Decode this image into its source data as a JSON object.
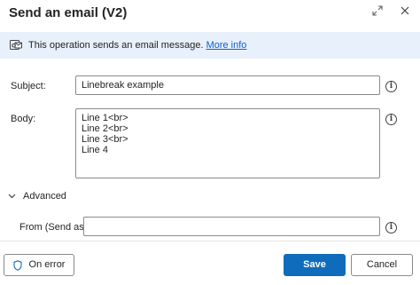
{
  "dialog": {
    "title": "Send an email (V2)",
    "expand_icon": "expand-icon",
    "close_icon": "close-icon"
  },
  "info": {
    "text": "This operation sends an email message.",
    "link": "More info",
    "icon": "mail-info-icon"
  },
  "fields": {
    "subject_label": "Subject:",
    "subject_value": "Linebreak example",
    "body_label": "Body:",
    "body_lines": [
      "Line 1<br>",
      "Line 2<br>",
      "Line 3<br>",
      "Line 4"
    ],
    "advanced_label": "Advanced",
    "from_label": "From (Send as):",
    "from_value": "",
    "help_glyph": "i"
  },
  "footer": {
    "on_error_label": "On error",
    "save_label": "Save",
    "cancel_label": "Cancel"
  },
  "colors": {
    "accent": "#0f6cbd",
    "info_bar_bg": "#e8f0fb",
    "link": "#0f5fd1"
  }
}
